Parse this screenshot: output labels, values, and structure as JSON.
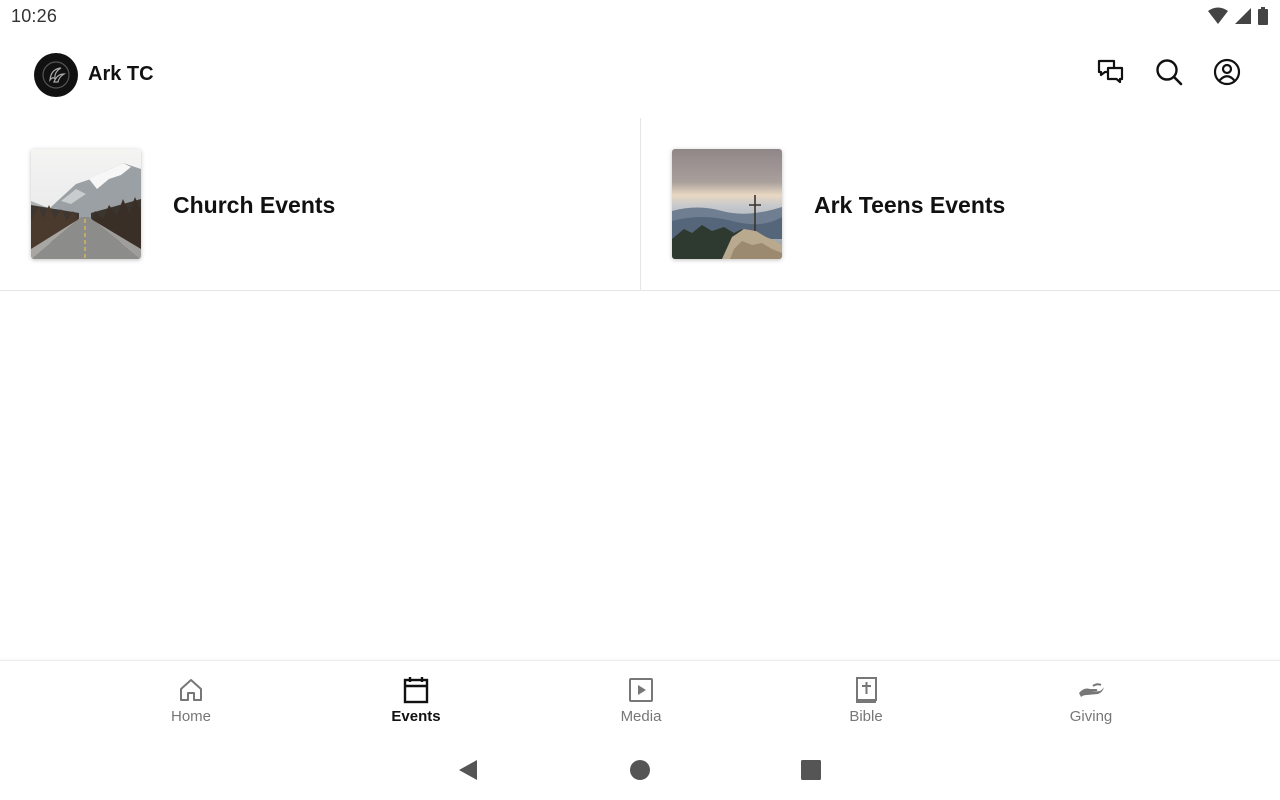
{
  "status_bar": {
    "time": "10:26",
    "icons": [
      "wifi-icon",
      "cell-signal-icon",
      "battery-icon"
    ]
  },
  "app_bar": {
    "title": "Ark TC",
    "logo": "ark-tc-logo",
    "actions": [
      "chat-icon",
      "search-icon",
      "account-icon"
    ]
  },
  "cards": [
    {
      "title": "Church Events",
      "thumbnail": "mountain-road-photo"
    },
    {
      "title": "Ark Teens Events",
      "thumbnail": "mountain-cross-photo"
    }
  ],
  "bottom_nav": {
    "active": "Events",
    "items": [
      {
        "label": "Home",
        "icon": "home-icon"
      },
      {
        "label": "Events",
        "icon": "calendar-icon"
      },
      {
        "label": "Media",
        "icon": "play-icon"
      },
      {
        "label": "Bible",
        "icon": "bible-icon"
      },
      {
        "label": "Giving",
        "icon": "giving-hand-icon"
      }
    ]
  },
  "system_nav": [
    "back-button",
    "home-button",
    "recents-button"
  ],
  "colors": {
    "text_primary": "#111111",
    "text_inactive": "#777777",
    "divider": "#e6e6e6"
  }
}
